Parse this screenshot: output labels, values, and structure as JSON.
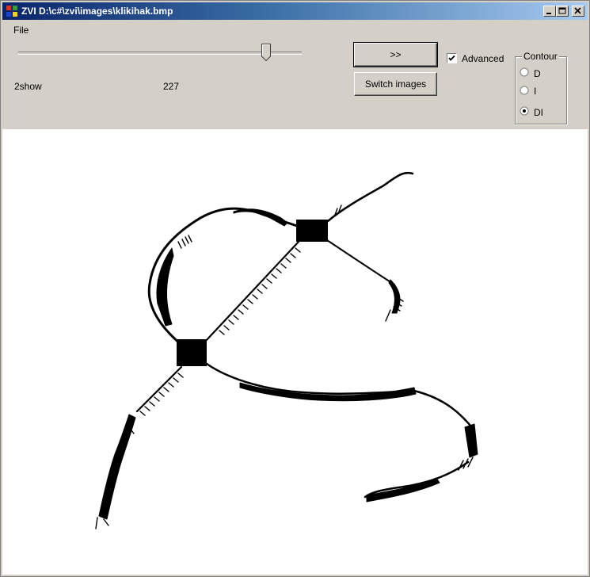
{
  "window": {
    "title": "ZVI D:\\c#\\zvi\\images\\klikihak.bmp"
  },
  "menu": {
    "file_label": "File"
  },
  "controls": {
    "slider_value": 227,
    "slider_max": 255,
    "label_2show": "2show",
    "value_text": "227",
    "next_button": ">>",
    "switch_button": "Switch images",
    "advanced_label": "Advanced",
    "advanced_checked": true
  },
  "contour": {
    "title": "Contour",
    "options": [
      "D",
      "I",
      "DI"
    ],
    "selected": "DI"
  },
  "icons": {
    "app": "app-icon",
    "minimize": "minimize-icon",
    "maximize": "maximize-icon",
    "close": "close-icon"
  },
  "colors": {
    "titlebar_start": "#0a246a",
    "titlebar_end": "#a6caf0",
    "face": "#d4d0c8",
    "canvas": "#ffffff",
    "ink": "#000000"
  }
}
